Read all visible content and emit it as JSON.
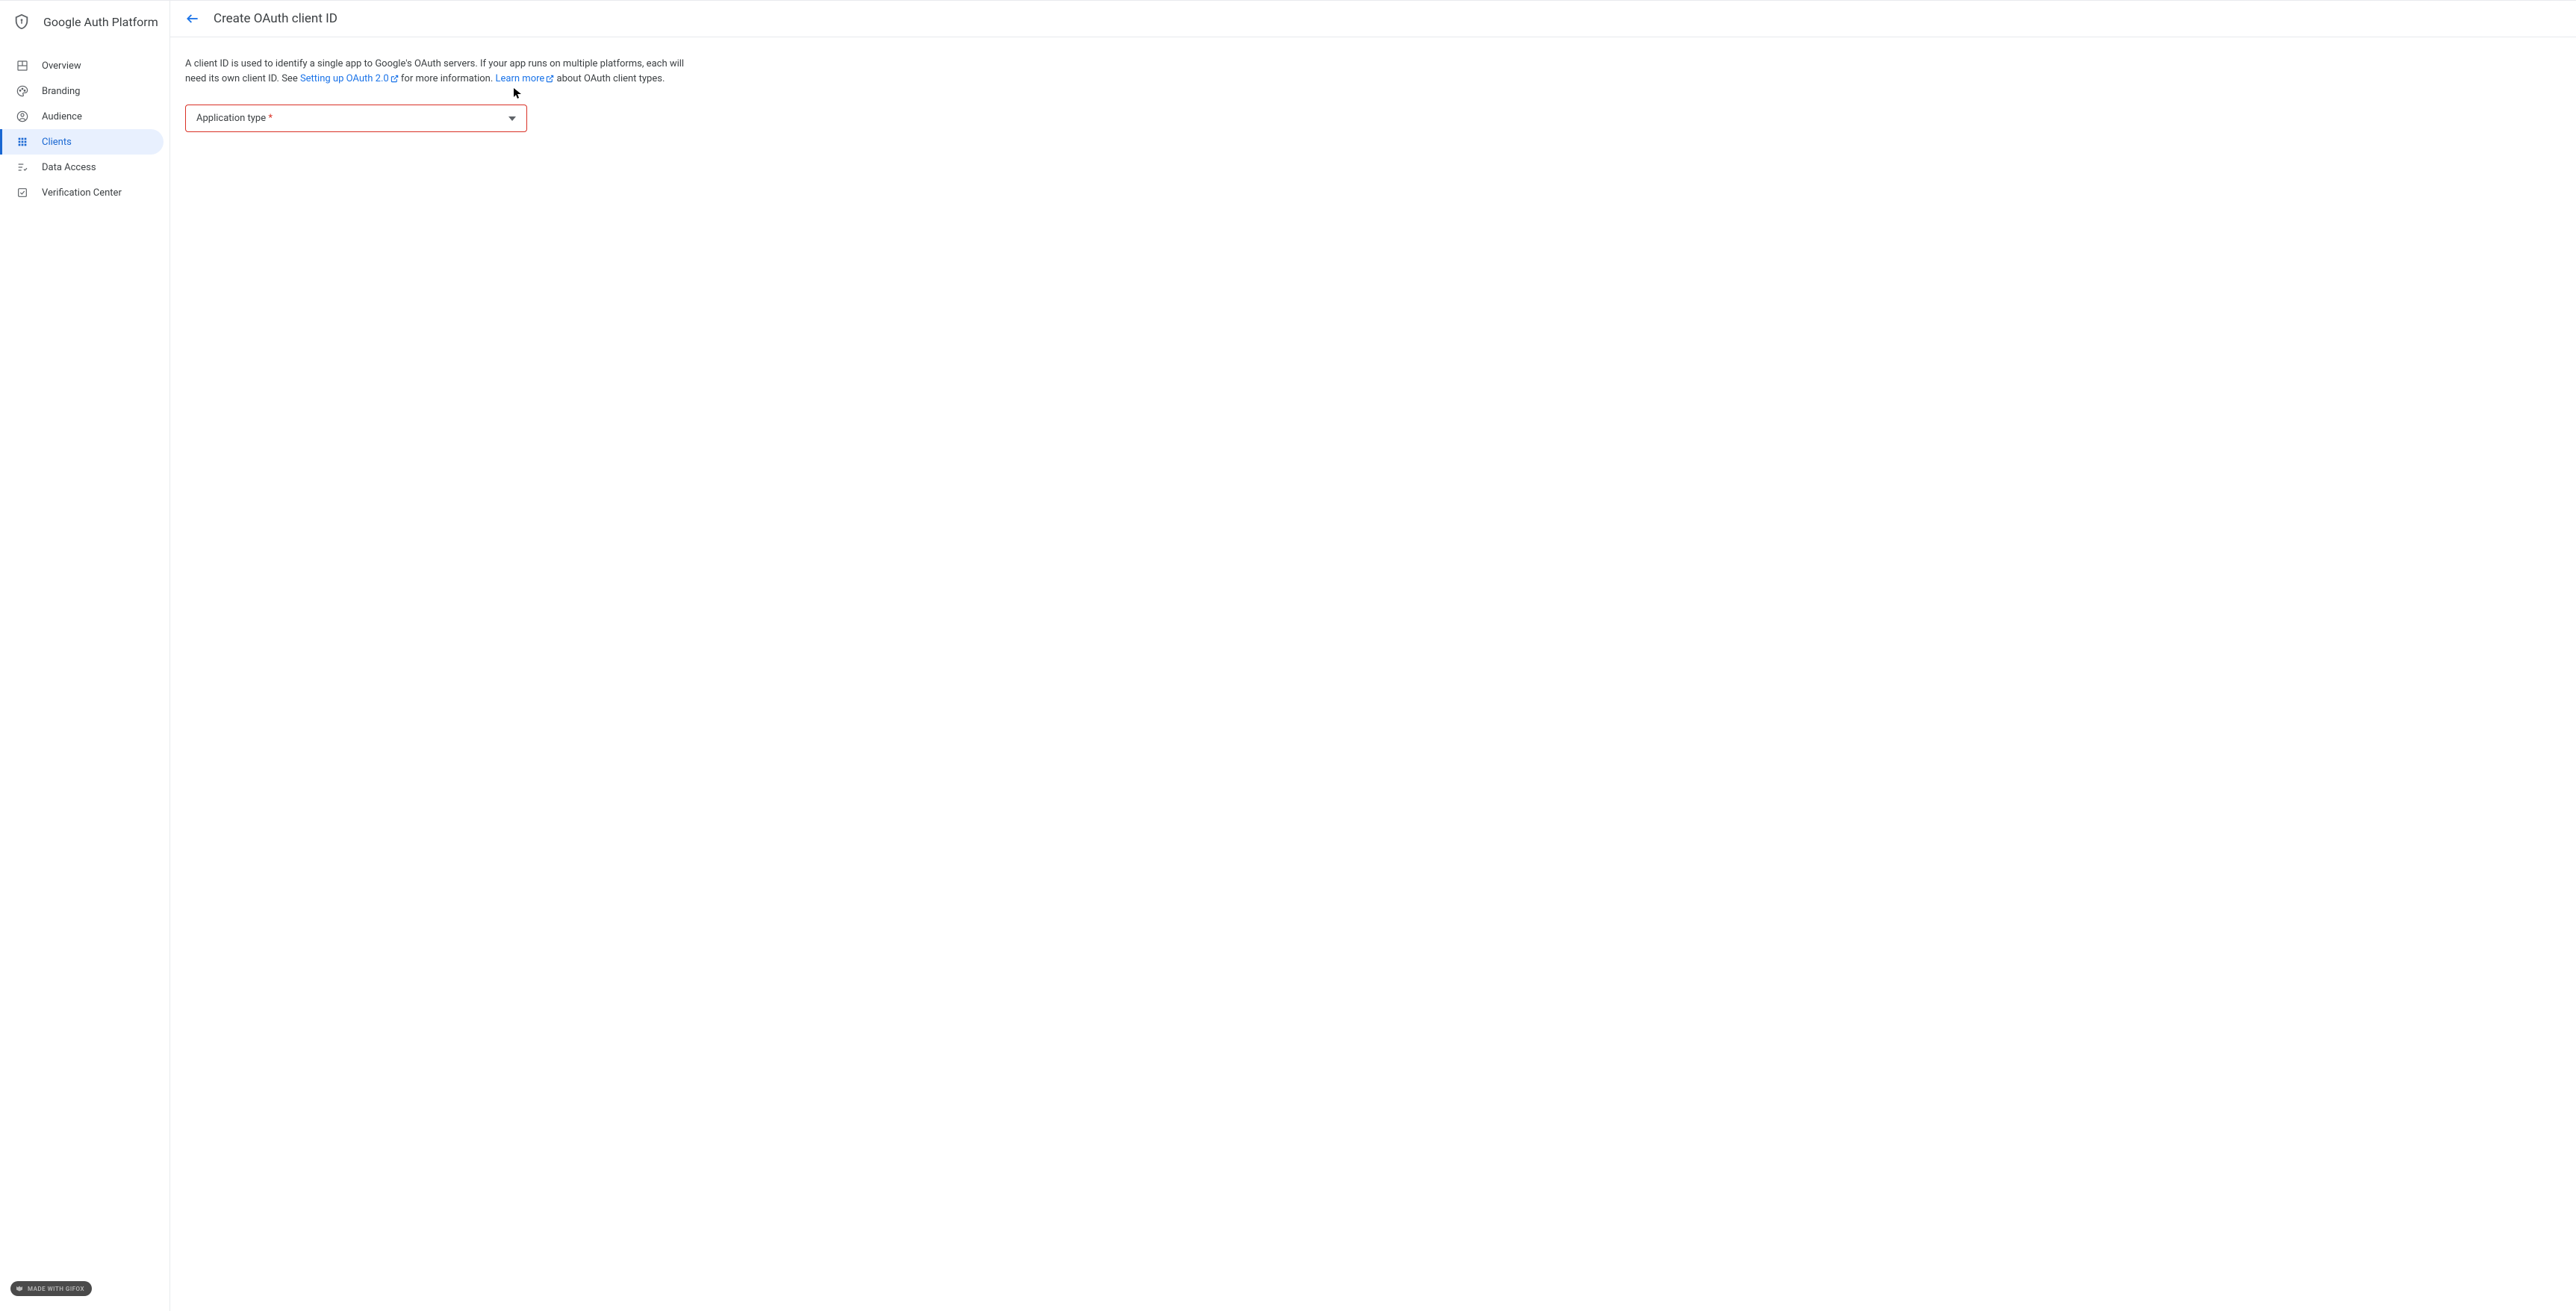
{
  "sidebar": {
    "title": "Google Auth Platform",
    "nav": [
      {
        "label": "Overview",
        "icon": "dashboard"
      },
      {
        "label": "Branding",
        "icon": "palette"
      },
      {
        "label": "Audience",
        "icon": "account"
      },
      {
        "label": "Clients",
        "icon": "apps",
        "active": true
      },
      {
        "label": "Data Access",
        "icon": "list-check"
      },
      {
        "label": "Verification Center",
        "icon": "verify"
      }
    ]
  },
  "header": {
    "title": "Create OAuth client ID"
  },
  "description": {
    "text1": "A client ID is used to identify a single app to Google's OAuth servers. If your app runs on multiple platforms, each will need its own client ID. See ",
    "link1": "Setting up OAuth 2.0",
    "text2": " for more information. ",
    "link2": "Learn more",
    "text3": " about OAuth client types."
  },
  "select": {
    "label": "Application type",
    "required": "*"
  },
  "badge": {
    "label": "MADE WITH GIFOX"
  }
}
